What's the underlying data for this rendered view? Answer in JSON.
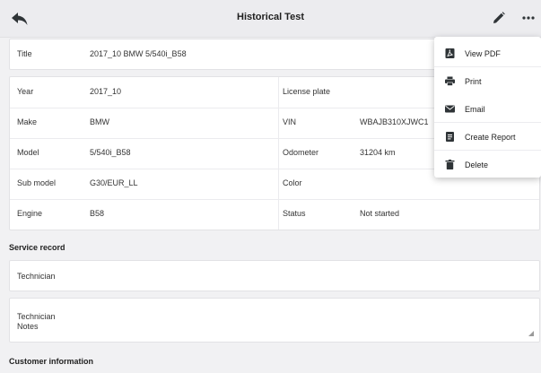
{
  "header": {
    "title": "Historical Test",
    "back_icon": "back-arrow-icon",
    "edit_icon": "pencil-icon",
    "more_icon": "more-horizontal-icon"
  },
  "title_row": {
    "label": "Title",
    "value": "2017_10 BMW 5/540i_B58"
  },
  "vehicle_left": [
    {
      "label": "Year",
      "value": "2017_10"
    },
    {
      "label": "Make",
      "value": "BMW"
    },
    {
      "label": "Model",
      "value": "5/540i_B58"
    },
    {
      "label": "Sub model",
      "value": "G30/EUR_LL"
    },
    {
      "label": "Engine",
      "value": "B58"
    }
  ],
  "vehicle_right": [
    {
      "label": "License plate",
      "value": ""
    },
    {
      "label": "VIN",
      "value": "WBAJB310XJWC1"
    },
    {
      "label": "Odometer",
      "value": "31204 km"
    },
    {
      "label": "Color",
      "value": ""
    },
    {
      "label": "Status",
      "value": "Not started"
    }
  ],
  "service_record": {
    "heading": "Service record",
    "technician_label": "Technician",
    "notes_label_line1": "Technician",
    "notes_label_line2": "Notes"
  },
  "customer_info": {
    "heading": "Customer information"
  },
  "menu": {
    "items": [
      {
        "label": "View PDF",
        "icon": "pdf-icon"
      },
      {
        "label": "Print",
        "icon": "print-icon"
      },
      {
        "label": "Email",
        "icon": "email-icon"
      },
      {
        "label": "Create Report",
        "icon": "report-icon"
      },
      {
        "label": "Delete",
        "icon": "trash-icon"
      }
    ]
  }
}
